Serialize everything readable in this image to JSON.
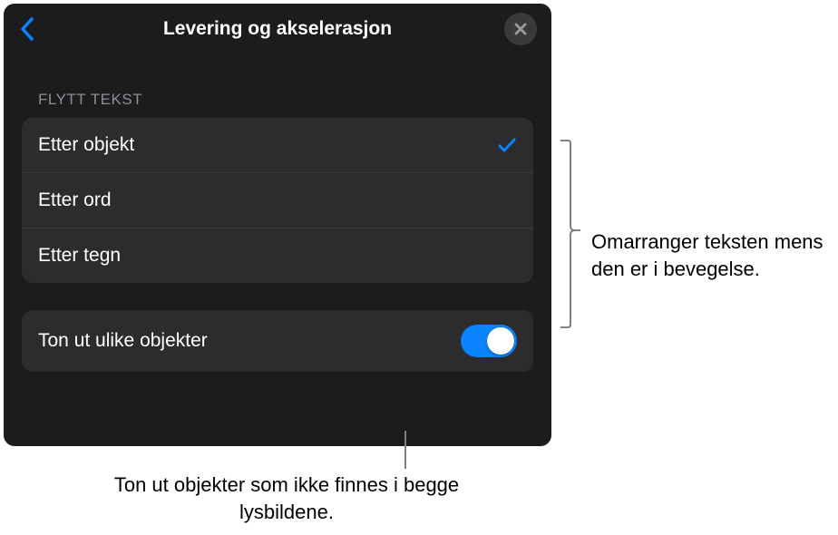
{
  "header": {
    "title": "Levering og akselerasjon"
  },
  "section": {
    "label": "FLYTT TEKST",
    "options": [
      {
        "label": "Etter objekt",
        "selected": true
      },
      {
        "label": "Etter ord",
        "selected": false
      },
      {
        "label": "Etter tegn",
        "selected": false
      }
    ]
  },
  "toggle": {
    "label": "Ton ut ulike objekter",
    "on": true
  },
  "annotations": {
    "right": "Omarranger teksten mens den er i bevegelse.",
    "bottom": "Ton ut objekter som ikke finnes i begge lysbildene."
  }
}
